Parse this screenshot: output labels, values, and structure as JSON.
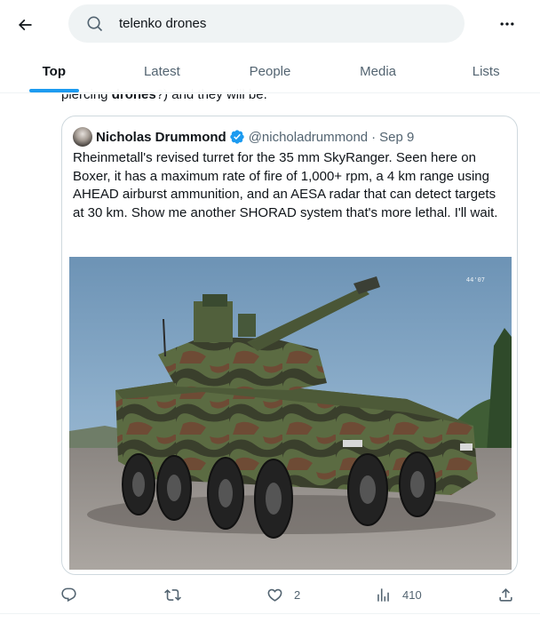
{
  "search": {
    "query": "telenko drones"
  },
  "tabs": [
    {
      "label": "Top",
      "active": true
    },
    {
      "label": "Latest",
      "active": false
    },
    {
      "label": "People",
      "active": false
    },
    {
      "label": "Media",
      "active": false
    },
    {
      "label": "Lists",
      "active": false
    }
  ],
  "post": {
    "partial_text_prefix": "piercing ",
    "partial_text_bold": "drones",
    "partial_text_suffix": "?) and they will be."
  },
  "quote": {
    "author_name": "Nicholas Drummond",
    "verified": true,
    "handle": "@nicholadrummond",
    "separator": "·",
    "date": "Sep 9",
    "text": "Rheinmetall's revised turret for the 35 mm SkyRanger. Seen here on Boxer, it has a maximum rate of fire of 1,000+ rpm,  a 4 km range using AHEAD airburst ammunition, and an AESA radar that can detect targets at 30 km. Show me another SHORAD system that's more lethal. I'll wait.",
    "image_watermark": "44'07"
  },
  "actions": {
    "replies": "",
    "reposts": "",
    "likes": "2",
    "views": "410"
  },
  "icons": {
    "back": "arrow-left-icon",
    "search": "search-icon",
    "more": "more-horizontal-icon",
    "verified": "verified-badge-icon",
    "reply": "reply-icon",
    "repost": "repost-icon",
    "like": "heart-icon",
    "views": "views-chart-icon",
    "share": "share-icon"
  },
  "colors": {
    "accent": "#1d9bf0",
    "text_primary": "#0f1419",
    "text_secondary": "#536471",
    "border": "#cfd9de",
    "search_bg": "#eff3f4"
  }
}
